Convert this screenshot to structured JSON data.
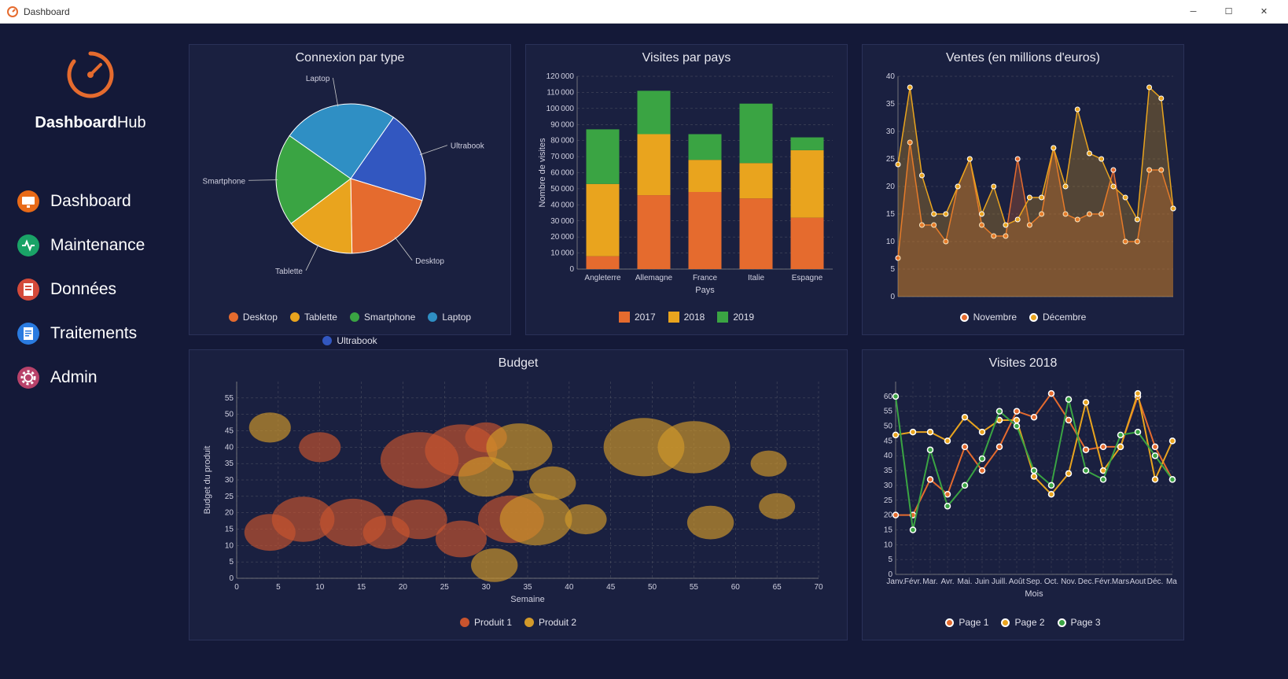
{
  "window_title": "Dashboard",
  "logo": {
    "prefix": "Dashboard",
    "suffix": "Hub"
  },
  "nav": [
    {
      "label": "Dashboard",
      "icon_bg": "#e86a17",
      "icon": "monitor"
    },
    {
      "label": "Maintenance",
      "icon_bg": "#1aa367",
      "icon": "pulse"
    },
    {
      "label": "Données",
      "icon_bg": "#d44a3a",
      "icon": "page"
    },
    {
      "label": "Traitements",
      "icon_bg": "#2a7be0",
      "icon": "doc"
    },
    {
      "label": "Admin",
      "icon_bg": "#b8426a",
      "icon": "gear"
    }
  ],
  "colors": {
    "orange": "#e56b2e",
    "yellow": "#e9a41e",
    "green": "#3aa443",
    "blue": "#2f8fc4",
    "dblue": "#3257c0",
    "bubble1": "#c9542e",
    "bubble2": "#d39a2a"
  },
  "chart_data": [
    {
      "id": "connexion",
      "type": "pie",
      "title": "Connexion par type",
      "series": [
        {
          "name": "Desktop",
          "value": 20,
          "color": "#e56b2e"
        },
        {
          "name": "Tablette",
          "value": 15,
          "color": "#e9a41e"
        },
        {
          "name": "Smartphone",
          "value": 20,
          "color": "#3aa443"
        },
        {
          "name": "Laptop",
          "value": 25,
          "color": "#2f8fc4"
        },
        {
          "name": "Ultrabook",
          "value": 20,
          "color": "#3257c0"
        }
      ],
      "outer_labels": [
        "Ultrabook",
        "Desktop",
        "Tablette",
        "Smartphone",
        "Laptop"
      ]
    },
    {
      "id": "visites_pays",
      "type": "bar",
      "title": "Visites par pays",
      "xlabel": "Pays",
      "ylabel": "Nombre de visites",
      "ylim": [
        0,
        120000
      ],
      "yticks": [
        0,
        10000,
        20000,
        30000,
        40000,
        50000,
        60000,
        70000,
        80000,
        90000,
        100000,
        110000,
        120000
      ],
      "categories": [
        "Angleterre",
        "Allemagne",
        "France",
        "Italie",
        "Espagne"
      ],
      "series": [
        {
          "name": "2017",
          "color": "#e56b2e",
          "values": [
            8000,
            46000,
            48000,
            44000,
            32000
          ]
        },
        {
          "name": "2018",
          "color": "#e9a41e",
          "values": [
            45000,
            38000,
            20000,
            22000,
            42000
          ]
        },
        {
          "name": "2019",
          "color": "#3aa443",
          "values": [
            34000,
            27000,
            16000,
            37000,
            8000
          ]
        }
      ]
    },
    {
      "id": "ventes",
      "type": "area",
      "title": "Ventes (en millions d'euros)",
      "ylim": [
        0,
        40
      ],
      "yticks": [
        0,
        5,
        10,
        15,
        20,
        25,
        30,
        35,
        40
      ],
      "x_count": 24,
      "series": [
        {
          "name": "Novembre",
          "color": "#e56b2e",
          "values": [
            7,
            28,
            13,
            13,
            10,
            20,
            25,
            13,
            11,
            11,
            25,
            13,
            15,
            27,
            15,
            14,
            15,
            15,
            23,
            10,
            10,
            23,
            23,
            16
          ]
        },
        {
          "name": "Décembre",
          "color": "#e9a41e",
          "values": [
            24,
            38,
            22,
            15,
            15,
            20,
            25,
            15,
            20,
            13,
            14,
            18,
            18,
            27,
            20,
            34,
            26,
            25,
            20,
            18,
            14,
            38,
            36,
            16
          ]
        }
      ]
    },
    {
      "id": "budget",
      "type": "bubble",
      "title": "Budget",
      "xlabel": "Semaine",
      "ylabel": "Budget du produit",
      "xlim": [
        0,
        70
      ],
      "ylim": [
        0,
        60
      ],
      "xticks": [
        0,
        5,
        10,
        15,
        20,
        25,
        30,
        35,
        40,
        45,
        50,
        55,
        60,
        65,
        70
      ],
      "yticks": [
        0,
        5,
        10,
        15,
        20,
        25,
        30,
        35,
        40,
        45,
        50,
        55
      ],
      "series": [
        {
          "name": "Produit 1",
          "color": "#c9542e",
          "data": [
            [
              4,
              14,
              60
            ],
            [
              8,
              18,
              90
            ],
            [
              14,
              17,
              100
            ],
            [
              22,
              18,
              70
            ],
            [
              22,
              36,
              140
            ],
            [
              27,
              39,
              120
            ],
            [
              10,
              40,
              40
            ],
            [
              18,
              14,
              50
            ],
            [
              27,
              12,
              60
            ],
            [
              33,
              18,
              100
            ],
            [
              30,
              43,
              40
            ]
          ]
        },
        {
          "name": "Produit 2",
          "color": "#d39a2a",
          "data": [
            [
              4,
              46,
              40
            ],
            [
              30,
              31,
              70
            ],
            [
              34,
              40,
              100
            ],
            [
              36,
              18,
              120
            ],
            [
              38,
              29,
              50
            ],
            [
              42,
              18,
              40
            ],
            [
              31,
              4,
              50
            ],
            [
              49,
              40,
              150
            ],
            [
              55,
              40,
              120
            ],
            [
              57,
              17,
              50
            ],
            [
              65,
              22,
              30
            ],
            [
              64,
              35,
              30
            ]
          ]
        }
      ]
    },
    {
      "id": "visites2018",
      "type": "line",
      "title": "Visites 2018",
      "xlabel": "Mois",
      "ylim": [
        0,
        65
      ],
      "yticks": [
        0,
        5,
        10,
        15,
        20,
        25,
        30,
        35,
        40,
        45,
        50,
        55,
        60
      ],
      "categories": [
        "Janv.",
        "Févr.",
        "Mar.",
        "Avr.",
        "Mai.",
        "Juin",
        "Juill.",
        "Août",
        "Sep.",
        "Oct.",
        "Nov.",
        "Dec.",
        "Févr.",
        "Mars",
        "Aout",
        "Déc.",
        "Mai"
      ],
      "series": [
        {
          "name": "Page 1",
          "color": "#e56b2e",
          "values": [
            20,
            20,
            32,
            27,
            43,
            35,
            43,
            55,
            53,
            61,
            52,
            42,
            43,
            43,
            60,
            43,
            32
          ]
        },
        {
          "name": "Page 2",
          "color": "#e9a41e",
          "values": [
            47,
            48,
            48,
            45,
            53,
            48,
            52,
            52,
            33,
            27,
            34,
            58,
            35,
            43,
            61,
            32,
            45
          ]
        },
        {
          "name": "Page 3",
          "color": "#3aa443",
          "values": [
            60,
            15,
            42,
            23,
            30,
            39,
            55,
            50,
            35,
            30,
            59,
            35,
            32,
            47,
            48,
            40,
            32
          ]
        }
      ]
    }
  ]
}
